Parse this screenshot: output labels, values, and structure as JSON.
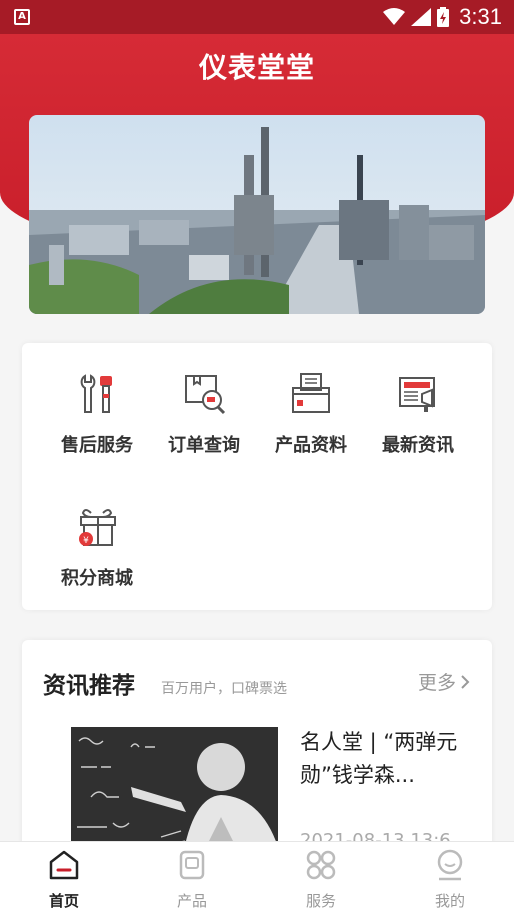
{
  "status_bar": {
    "time": "3:31",
    "app_icon_letter": "A"
  },
  "header": {
    "title": "仪表堂堂"
  },
  "functions": [
    {
      "label": "售后服务",
      "icon": "tools-icon"
    },
    {
      "label": "订单查询",
      "icon": "order-search-icon"
    },
    {
      "label": "产品资料",
      "icon": "product-docs-icon"
    },
    {
      "label": "最新资讯",
      "icon": "news-icon"
    },
    {
      "label": "积分商城",
      "icon": "gift-icon"
    }
  ],
  "news": {
    "title": "资讯推荐",
    "subtitle": "百万用户，口碑票选",
    "more": "更多",
    "item": {
      "headline": "名人堂 | “两弹元勋”钱学森...",
      "date": "2021-08-13 13:6"
    }
  },
  "tabs": [
    {
      "label": "首页",
      "active": true
    },
    {
      "label": "产品",
      "active": false
    },
    {
      "label": "服务",
      "active": false
    },
    {
      "label": "我的",
      "active": false
    }
  ],
  "colors": {
    "primary": "#c81e2a",
    "status_bar": "#a61b26",
    "icon_accent": "#e23a3a"
  }
}
